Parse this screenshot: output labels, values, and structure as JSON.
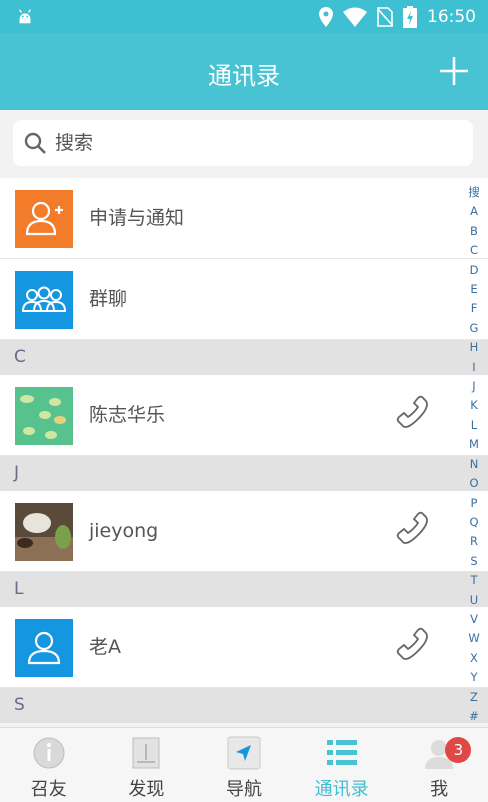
{
  "status_bar": {
    "time": "16:50"
  },
  "header": {
    "title": "通讯录",
    "add_icon": "plus-icon"
  },
  "search": {
    "placeholder": "搜索",
    "value": ""
  },
  "fixed_items": [
    {
      "label": "申请与通知",
      "icon": "add-person-icon",
      "color": "#f27c2a"
    },
    {
      "label": "群聊",
      "icon": "group-icon",
      "color": "#1596e0"
    }
  ],
  "sections": [
    {
      "letter": "C",
      "contacts": [
        {
          "name": "陈志华乐"
        }
      ]
    },
    {
      "letter": "J",
      "contacts": [
        {
          "name": "jieyong"
        }
      ]
    },
    {
      "letter": "L",
      "contacts": [
        {
          "name": "老A"
        }
      ]
    },
    {
      "letter": "S",
      "contacts": []
    }
  ],
  "index_letters": [
    "搜",
    "A",
    "B",
    "C",
    "D",
    "E",
    "F",
    "G",
    "H",
    "I",
    "J",
    "K",
    "L",
    "M",
    "N",
    "O",
    "P",
    "Q",
    "R",
    "S",
    "T",
    "U",
    "V",
    "W",
    "X",
    "Y",
    "Z",
    "#"
  ],
  "tabs": [
    {
      "label": "召友",
      "icon": "info-circle-icon",
      "active": false
    },
    {
      "label": "发现",
      "icon": "discover-icon",
      "active": false
    },
    {
      "label": "导航",
      "icon": "navigation-icon",
      "active": false
    },
    {
      "label": "通讯录",
      "icon": "contacts-list-icon",
      "active": true
    },
    {
      "label": "我",
      "icon": "profile-icon",
      "active": false,
      "badge": "3"
    }
  ],
  "colors": {
    "accent": "#48c3d4",
    "status_bar": "#3fbfd2",
    "badge": "#e04848"
  }
}
